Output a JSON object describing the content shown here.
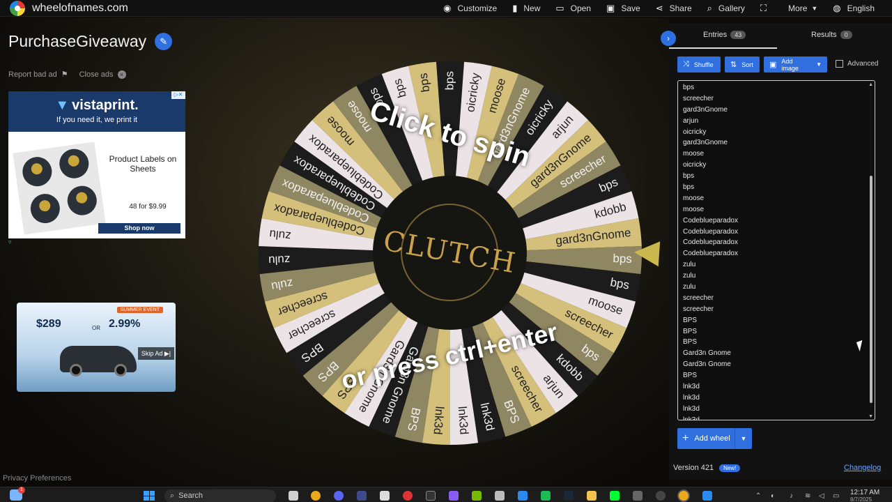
{
  "site": {
    "name": "wheelofnames.com"
  },
  "menu": [
    {
      "label": "Customize",
      "icon": "palette-icon",
      "glyph": "◉"
    },
    {
      "label": "New",
      "icon": "new-file-icon",
      "glyph": "▮"
    },
    {
      "label": "Open",
      "icon": "folder-icon",
      "glyph": "▭"
    },
    {
      "label": "Save",
      "icon": "save-icon",
      "glyph": "▣"
    },
    {
      "label": "Share",
      "icon": "share-icon",
      "glyph": "⋖"
    },
    {
      "label": "Gallery",
      "icon": "search-icon",
      "glyph": "⌕"
    },
    {
      "label": "",
      "icon": "fullscreen-icon",
      "glyph": "⛶"
    },
    {
      "label": "More",
      "icon": "caret-down-icon",
      "glyph": ""
    },
    {
      "label": "English",
      "icon": "globe-icon",
      "glyph": "◍"
    }
  ],
  "page": {
    "title": "PurchaseGiveaway",
    "report_ad": "Report bad ad",
    "close_ads": "Close ads",
    "privacy": "Privacy Preferences"
  },
  "ad1": {
    "brand": "vistaprint.",
    "tagline": "If you need it, we print it",
    "product": "Product Labels on Sheets",
    "price": "48 for $9.99",
    "cta": "Shop now"
  },
  "ad2": {
    "price1": "$289",
    "or": "OR",
    "price2": "2.99%",
    "event": "SUMMER EVENT",
    "skip": "Skip Ad ▶|"
  },
  "wheel": {
    "spin_top": "Click to spin",
    "spin_bottom": "or press ctrl+enter",
    "center_logo": "CLUTCH",
    "colors": {
      "gold": "#d4c07a",
      "light": "#ece3e6",
      "dark": "#1c1c1c",
      "olive": "#8f8662"
    },
    "segments": [
      "bps",
      "oicricky",
      "moose",
      "gard3nGnome",
      "oicricky",
      "arjun",
      "gard3nGnome",
      "screecher",
      "bps",
      "kdobb",
      "gard3nGnome",
      "bps",
      "bps",
      "moose",
      "screecher",
      "bps",
      "kdobb",
      "arjun",
      "screecher",
      "BPS",
      "lnk3d",
      "lnk3d",
      "lnk3d",
      "BPS",
      "Gard3n Gnome",
      "Gard3n Gnome",
      "BPS",
      "BPS",
      "BPS",
      "screecher",
      "screecher",
      "zulu",
      "zulu",
      "zulu",
      "Codeblueparadox",
      "Codeblueparadox",
      "Codeblueparadox",
      "Codeblueparadox",
      "moose",
      "moose",
      "bps",
      "bps",
      "bps"
    ]
  },
  "panel": {
    "tabs": [
      {
        "label": "Entries",
        "count": "43"
      },
      {
        "label": "Results",
        "count": "0"
      }
    ],
    "buttons": {
      "shuffle": "Shuffle",
      "sort": "Sort",
      "add_image": "Add image",
      "advanced": "Advanced"
    },
    "entries": [
      "bps",
      "screecher",
      "gard3nGnome",
      "arjun",
      "oicricky",
      "gard3nGnome",
      "moose",
      "oicricky",
      "bps",
      "bps",
      "moose",
      "moose",
      "Codeblueparadox",
      "Codeblueparadox",
      "Codeblueparadox",
      "Codeblueparadox",
      "zulu",
      "zulu",
      "zulu",
      "screecher",
      "screecher",
      "BPS",
      "BPS",
      "BPS",
      "Gard3n Gnome",
      "Gard3n Gnome",
      "BPS",
      "lnk3d",
      "lnk3d",
      "lnk3d",
      "lnk3d"
    ],
    "add_wheel": "Add wheel",
    "version": "Version 421",
    "new_badge": "New!",
    "changelog": "Changelog"
  },
  "taskbar": {
    "search": "Search",
    "time": "12:17 AM",
    "date": "8/7/2025",
    "notif": "1"
  }
}
